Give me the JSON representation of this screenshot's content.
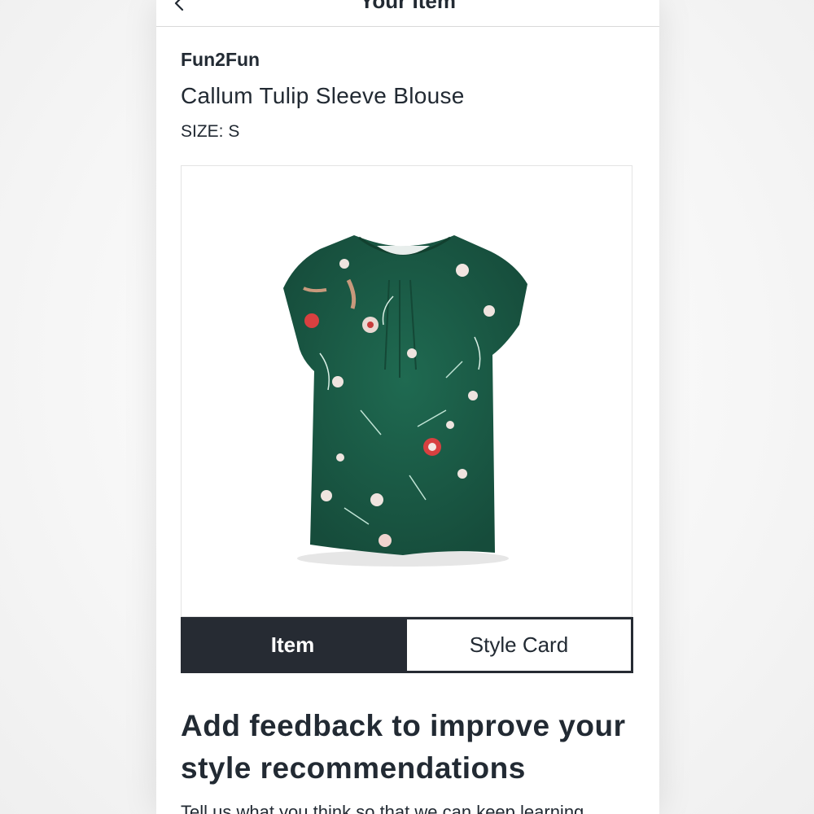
{
  "header": {
    "title": "Your Item",
    "back_icon": "chevron-left-icon"
  },
  "product": {
    "brand": "Fun2Fun",
    "name": "Callum Tulip Sleeve Blouse",
    "size": "SIZE: S",
    "image": "floral-blouse-image"
  },
  "tabs": [
    {
      "label": "Item",
      "active": true
    },
    {
      "label": "Style Card",
      "active": false
    }
  ],
  "feedback": {
    "heading": "Add feedback to improve your style recommendations",
    "body": "Tell us what you think so that we can keep learning"
  },
  "colors": {
    "dark": "#262b33",
    "blouse_green": "#1c5e48"
  }
}
